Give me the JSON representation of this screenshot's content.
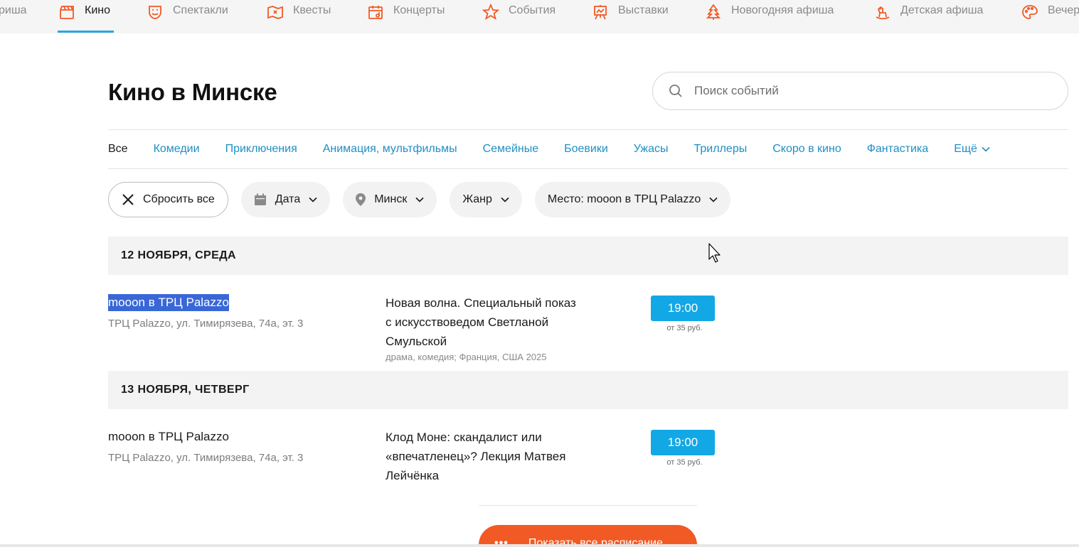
{
  "topnav": {
    "items": [
      {
        "label": "риша",
        "icon": "partial-icon",
        "active": false
      },
      {
        "label": "Кино",
        "icon": "clapperboard-icon",
        "active": true
      },
      {
        "label": "Спектакли",
        "icon": "theater-mask-icon",
        "active": false
      },
      {
        "label": "Квесты",
        "icon": "quest-map-icon",
        "active": false
      },
      {
        "label": "Концерты",
        "icon": "calendar-music-icon",
        "active": false
      },
      {
        "label": "События",
        "icon": "star-icon",
        "active": false
      },
      {
        "label": "Выставки",
        "icon": "easel-icon",
        "active": false
      },
      {
        "label": "Новогодняя афиша",
        "icon": "christmas-tree-icon",
        "active": false
      },
      {
        "label": "Детская афиша",
        "icon": "rocking-horse-icon",
        "active": false
      },
      {
        "label": "Вечер",
        "icon": "palette-icon",
        "active": false
      }
    ],
    "accent_color": "#f15a24",
    "underline_color": "#2ba6de"
  },
  "header": {
    "title": "Кино в Минске",
    "search_placeholder": "Поиск событий"
  },
  "genres": {
    "items": [
      "Все",
      "Комедии",
      "Приключения",
      "Анимация, мультфильмы",
      "Семейные",
      "Боевики",
      "Ужасы",
      "Триллеры",
      "Скоро в кино",
      "Фантастика"
    ],
    "current": "Все",
    "more_label": "Ещё",
    "link_color": "#1f8fc4"
  },
  "filters": {
    "reset_label": "Сбросить все",
    "date_label": "Дата",
    "city_label": "Минск",
    "genre_label": "Жанр",
    "place_label": "Место: mooon в ТРЦ Palazzo"
  },
  "days": [
    {
      "header": "12 НОЯБРЯ, СРЕДА",
      "venue": "mooon в ТРЦ Palazzo",
      "address": "ТРЦ Palazzo, ул. Тимирязева, 74а, эт. 3",
      "event_title": "Новая волна. Специальный показ с искусствоведом Светланой Смульской",
      "event_genre": "драма, комедия; Франция, США 2025",
      "time": "19:00",
      "price": "от 35 руб."
    },
    {
      "header": "13 НОЯБРЯ, ЧЕТВЕРГ",
      "venue": "mooon в ТРЦ Palazzo",
      "address": "ТРЦ Palazzo, ул. Тимирязева, 74а, эт. 3",
      "event_title": "Клод Моне: скандалист или «впечатленец»? Лекция Матвея Лейчёнка",
      "time": "19:00",
      "price": "от 35 руб."
    }
  ],
  "show_all": {
    "dots": "•••",
    "label": "Показать все расписание",
    "color": "#f15a24"
  },
  "time_button_color": "#12a8e6"
}
